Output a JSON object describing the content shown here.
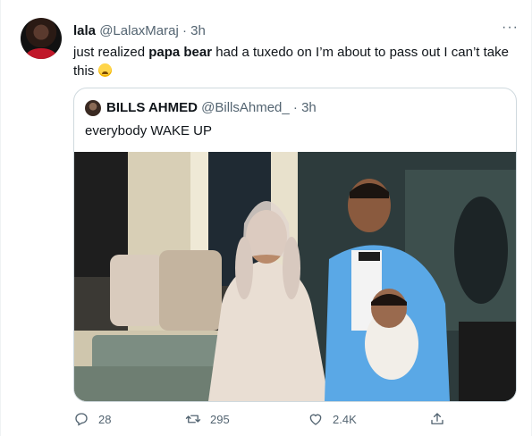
{
  "tweet": {
    "author_name": "lala",
    "author_handle": "@LalaxMaraj",
    "separator": "·",
    "time": "3h",
    "more_label": "···",
    "text_before": "just realized ",
    "text_bold": "papa bear",
    "text_after": " had a tuxedo on I’m about to pass out I can’t take this "
  },
  "quote": {
    "author_name": "BILLS AHMED",
    "author_handle": "@BillsAhmed_",
    "separator": "·",
    "time": "3h",
    "text": "everybody WAKE UP"
  },
  "actions": {
    "reply_count": "28",
    "retweet_count": "295",
    "like_count": "2.4K"
  },
  "icons": {
    "reply": "reply-icon",
    "retweet": "retweet-icon",
    "like": "heart-icon",
    "share": "share-icon"
  },
  "colors": {
    "text": "#0f1419",
    "muted": "#536471",
    "border": "#cfd9de",
    "suit": "#5aa8e6",
    "dress": "#e9ded3"
  }
}
